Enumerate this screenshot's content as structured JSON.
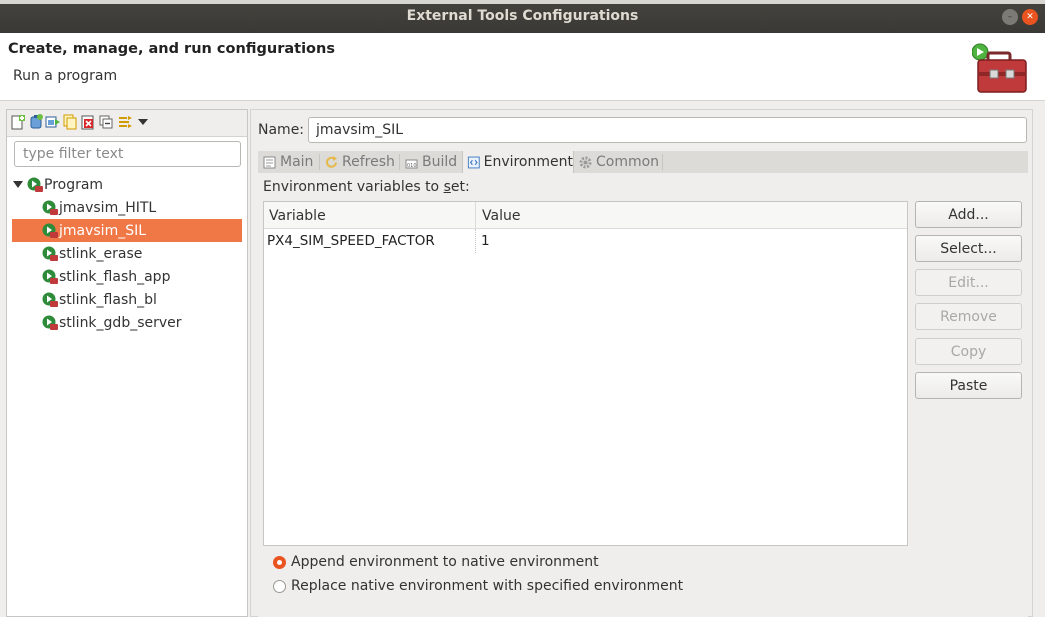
{
  "window": {
    "title": "External Tools Configurations",
    "close_glyph": "✕",
    "minimize_glyph": "–"
  },
  "header": {
    "title": "Create, manage, and run configurations",
    "subtitle": "Run a program"
  },
  "left_panel": {
    "toolbar_icons": [
      "new-config-icon",
      "new-prototype-icon",
      "export-icon",
      "duplicate-icon",
      "delete-icon",
      "collapse-all-icon",
      "filter-icon",
      "view-menu-icon"
    ],
    "filter_placeholder": "type filter text",
    "tree": {
      "root_label": "Program",
      "items": [
        {
          "label": "jmavsim_HITL",
          "selected": false
        },
        {
          "label": "jmavsim_SIL",
          "selected": true
        },
        {
          "label": "stlink_erase",
          "selected": false
        },
        {
          "label": "stlink_flash_app",
          "selected": false
        },
        {
          "label": "stlink_flash_bl",
          "selected": false
        },
        {
          "label": "stlink_gdb_server",
          "selected": false
        }
      ]
    }
  },
  "right_panel": {
    "name_label": "Name:",
    "name_value": "jmavsim_SIL",
    "tabs": [
      {
        "label": "Main",
        "active": false
      },
      {
        "label": "Refresh",
        "active": false
      },
      {
        "label": "Build",
        "active": false
      },
      {
        "label": "Environment",
        "active": true
      },
      {
        "label": "Common",
        "active": false
      }
    ],
    "environment": {
      "label_prefix": "Environment variables to ",
      "label_underlined": "s",
      "label_suffix": "et:",
      "columns": {
        "variable": "Variable",
        "value": "Value"
      },
      "rows": [
        {
          "variable": "PX4_SIM_SPEED_FACTOR",
          "value": "1"
        }
      ],
      "buttons": {
        "add": "Add...",
        "select": "Select...",
        "edit": "Edit...",
        "remove": "Remove",
        "copy": "Copy",
        "paste": "Paste"
      },
      "radio_append": "Append environment to native environment",
      "radio_replace": "Replace native environment with specified environment",
      "append_selected": true
    }
  },
  "colors": {
    "accent": "#e95420",
    "selection": "#f07746",
    "titlebar": "#3d3b37"
  }
}
